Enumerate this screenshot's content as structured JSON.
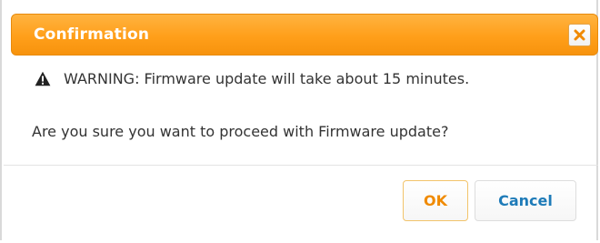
{
  "dialog": {
    "title": "Confirmation",
    "warning_text": "WARNING: Firmware update will take about 15 minutes.",
    "question_text": "Are you sure you want to proceed with Firmware update?",
    "ok_label": "OK",
    "cancel_label": "Cancel"
  },
  "icons": {
    "close": "close-icon",
    "warning": "warning-icon"
  },
  "colors": {
    "titlebar": "#ff9f1a",
    "ok_text": "#f08a00",
    "cancel_text": "#1e7bb8",
    "close_x": "#f08a00"
  }
}
